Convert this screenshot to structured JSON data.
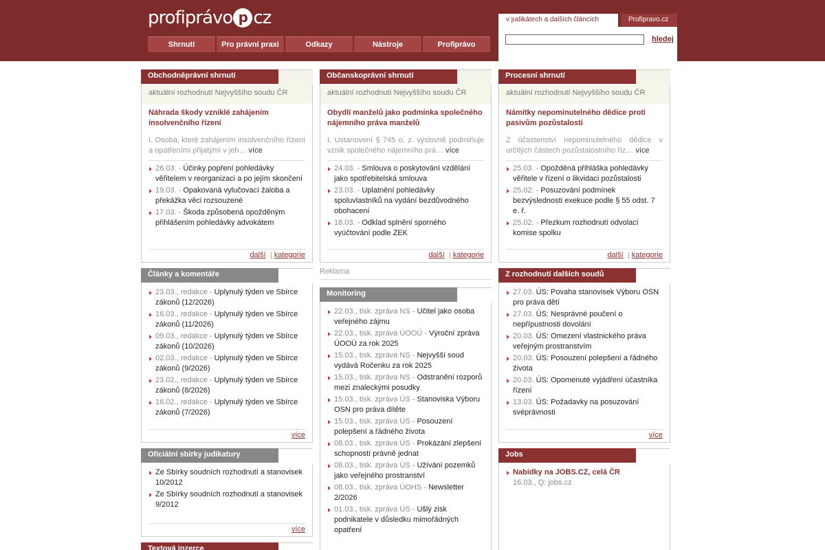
{
  "header": {
    "logo_text_left": "profiprávo",
    "logo_mark": "p",
    "logo_text_right": "cz",
    "nav": [
      "Shrnutí",
      "Pro právní praxi",
      "Odkazy",
      "Nástroje",
      "Profiprávo"
    ],
    "search_tabs": [
      "v judikátech a dalších článcích",
      "Profipravo.cz"
    ],
    "search_value": "",
    "search_button": "hledej"
  },
  "box1": {
    "title": "Obchodněprávní shrnutí",
    "subtitle": "aktuální rozhodnutí Nejvyššího soudu ČR",
    "lead_title": "Náhrada škody vzniklé zahájením insolvenčního řízení",
    "lead_text": "I. Osoba, které zahájením insolvenčního řízení a opatřeními přijatými v jeh…",
    "more": "více",
    "items": [
      {
        "date": "26.03. - ",
        "text": "Účinky popření pohledávky věřitelem v reorganizaci a po jejím skončení"
      },
      {
        "date": "19.03. - ",
        "text": "Opakovaná vylučovací žaloba a překážka věci rozsouzené"
      },
      {
        "date": "17.03. - ",
        "text": "Škoda způsobená opožděným přihlášením pohledávky advokátem"
      }
    ],
    "foot_next": "další",
    "foot_sep": "|",
    "foot_cat": "kategorie"
  },
  "box2": {
    "title": "Občanskoprávní shrnutí",
    "subtitle": "aktuální rozhodnutí Nejvyššího soudu ČR",
    "lead_title": "Obydlí manželů jako podmínka společného nájemního práva manželů",
    "lead_text": "I. Ustanovení § 745 o. z. výslovně podmiňuje vznik společného nájemního prá…",
    "more": "více",
    "items": [
      {
        "date": "24.03. - ",
        "text": "Smlouva o poskytování vzdělání jako spotřebitelská smlouva"
      },
      {
        "date": "23.03. - ",
        "text": "Uplatnění pohledávky spoluvlastníků na vydání bezdůvodného obohacení"
      },
      {
        "date": "18.03. - ",
        "text": "Odklad splnění sporného vyúčtování podle ZEK"
      }
    ],
    "foot_next": "další",
    "foot_sep": "|",
    "foot_cat": "kategorie"
  },
  "box3": {
    "title": "Procesní shrnutí",
    "subtitle": "aktuální rozhodnutí Nejvyššího soudu ČR",
    "lead_title": "Námitky nepominutelného dědice proti pasivům pozůstalosti",
    "lead_text": "Z účastenství nepominutelného dědice v určitých částech pozůstalostního říz…",
    "more": "více",
    "items": [
      {
        "date": "25.03. - ",
        "text": "Opožděná přihláška pohledávky věřitele v řízení o likvidaci pozůstalosti"
      },
      {
        "date": "25.02. - ",
        "text": "Posuzování podmínek bezvýslednosti exekuce podle § 55 odst. 7 e. ř."
      },
      {
        "date": "25.02. - ",
        "text": "Přezkum rozhodnutí odvolací komise spolku"
      }
    ],
    "foot_next": "další",
    "foot_sep": "|",
    "foot_cat": "kategorie"
  },
  "clanky": {
    "title": "Články a komentáře",
    "items": [
      {
        "date": "23.03., redakce - ",
        "text": "Uplynulý týden ve Sbírce zákonů (12/2026)"
      },
      {
        "date": "16.03., redakce - ",
        "text": "Uplynulý týden ve Sbírce zákonů (11/2026)"
      },
      {
        "date": "09.03., redakce - ",
        "text": "Uplynulý týden ve Sbírce zákonů (10/2026)"
      },
      {
        "date": "02.03., redakce - ",
        "text": "Uplynulý týden ve Sbírce zákonů (9/2026)"
      },
      {
        "date": "23.02., redakce - ",
        "text": "Uplynulý týden ve Sbírce zákonů (8/2026)"
      },
      {
        "date": "16.02., redakce - ",
        "text": "Uplynulý týden ve Sbírce zákonů (7/2026)"
      }
    ],
    "more": "více"
  },
  "reklama": "Reklama",
  "monitoring": {
    "title": "Monitoring",
    "items": [
      {
        "date": "22.03., tisk. zpráva NS - ",
        "text": "Učitel jako osoba veřejného zájmu"
      },
      {
        "date": "22.03., tisk. zpráva ÚOOÚ - ",
        "text": "Výroční zpráva ÚOOÚ za rok 2025"
      },
      {
        "date": "15.03., tisk. zpráva NS - ",
        "text": "Nejvyšší soud vydává Ročenku za rok 2025"
      },
      {
        "date": "15.03., tisk. zpráva NS - ",
        "text": "Odstranění rozporů mezi znaleckými posudky"
      },
      {
        "date": "15.03., tisk. zpráva ÚS - ",
        "text": "Stanoviska Výboru OSN pro práva dítěte"
      },
      {
        "date": "15.03., tisk. zpráva ÚS - ",
        "text": "Posouzení polepšení a řádného života"
      },
      {
        "date": "08.03., tisk. zpráva ÚS - ",
        "text": "Prokázání zlepšení schopností právně jednat"
      },
      {
        "date": "08.03., tisk. zpráva ÚS - ",
        "text": "Užívání pozemků jako veřejného prostranství"
      },
      {
        "date": "08.03., tisk. zpráva ÚOHS - ",
        "text": "Newsletter 2/2026"
      },
      {
        "date": "01.03., tisk. zpráva ÚS - ",
        "text": "Ušlý zisk podnikatele v důsledku mimořádných opatření"
      }
    ]
  },
  "dalsich": {
    "title": "Z rozhodnutí dalších soudů",
    "items": [
      {
        "date": "27.03. ",
        "text": "ÚS: Povaha stanovisek Výboru OSN pro práva dětí"
      },
      {
        "date": "27.03. ",
        "text": "ÚS: Nesprávné poučení o nepřípustnosti dovolání"
      },
      {
        "date": "20.03. ",
        "text": "ÚS: Omezení vlastnického práva veřejným prostranstvím"
      },
      {
        "date": "20.03. ",
        "text": "ÚS: Posouzení polepšení a řádného života"
      },
      {
        "date": "20.03. ",
        "text": "ÚS: Opomenuté vyjádření účastníka řízení"
      },
      {
        "date": "13.03. ",
        "text": "ÚS: Požadavky na posuzování svéprávnosti"
      }
    ],
    "more": "více"
  },
  "sbirky": {
    "title": "Oficiální sbírky judikatury",
    "items": [
      "Ze Sbírky soudních rozhodnutí a stanovisek 10/2012",
      "Ze Sbírky soudních rozhodnutí a stanovisek 9/2012"
    ],
    "more": "více"
  },
  "jobs": {
    "title": "Jobs",
    "job_title": "Nabídky na JOBS.CZ, celá ČR",
    "job_meta": "16.03., Q: jobs.cz"
  },
  "inzerce": {
    "title": "Textová inzerce"
  },
  "colors": {
    "header": "#7d2b2b",
    "accent": "#8b3131",
    "tab": "#a54444"
  }
}
